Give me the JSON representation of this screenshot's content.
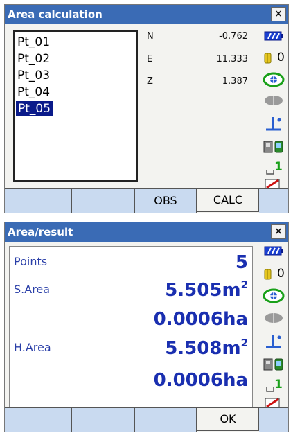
{
  "panel1": {
    "title": "Area calculation",
    "close": "×",
    "points": [
      "Pt_01",
      "Pt_02",
      "Pt_03",
      "Pt_04",
      "Pt_05"
    ],
    "selected_point": "Pt_05",
    "coords": [
      {
        "label": "N",
        "value": "-0.762"
      },
      {
        "label": "E",
        "value": "11.333"
      },
      {
        "label": "Z",
        "value": "1.387"
      }
    ],
    "battery_level": "0",
    "counter": "1",
    "softkeys": [
      "",
      "",
      "OBS",
      "CALC",
      ""
    ]
  },
  "panel2": {
    "title": "Area/result",
    "close": "×",
    "points_label": "Points",
    "points_value": "5",
    "s_area_label": "S.Area",
    "s_area_m2": "5.505m",
    "s_area_ha": "0.0006ha",
    "h_area_label": "H.Area",
    "h_area_m2": "5.508m",
    "h_area_ha": "0.0006ha",
    "squared": "2",
    "battery_level": "0",
    "counter": "1",
    "softkeys": [
      "",
      "",
      "",
      "OK",
      ""
    ]
  },
  "colors": {
    "titlebar": "#3a6bb5",
    "softkey": "#c9daf0",
    "result_text": "#1a2fb0",
    "selection": "#0a1a8a"
  },
  "icons": [
    "battery-icon",
    "prism-icon",
    "target-icon",
    "prism-shape-icon",
    "tilt-icon",
    "instrument-controller-icon",
    "counter-icon",
    "pen-icon"
  ]
}
